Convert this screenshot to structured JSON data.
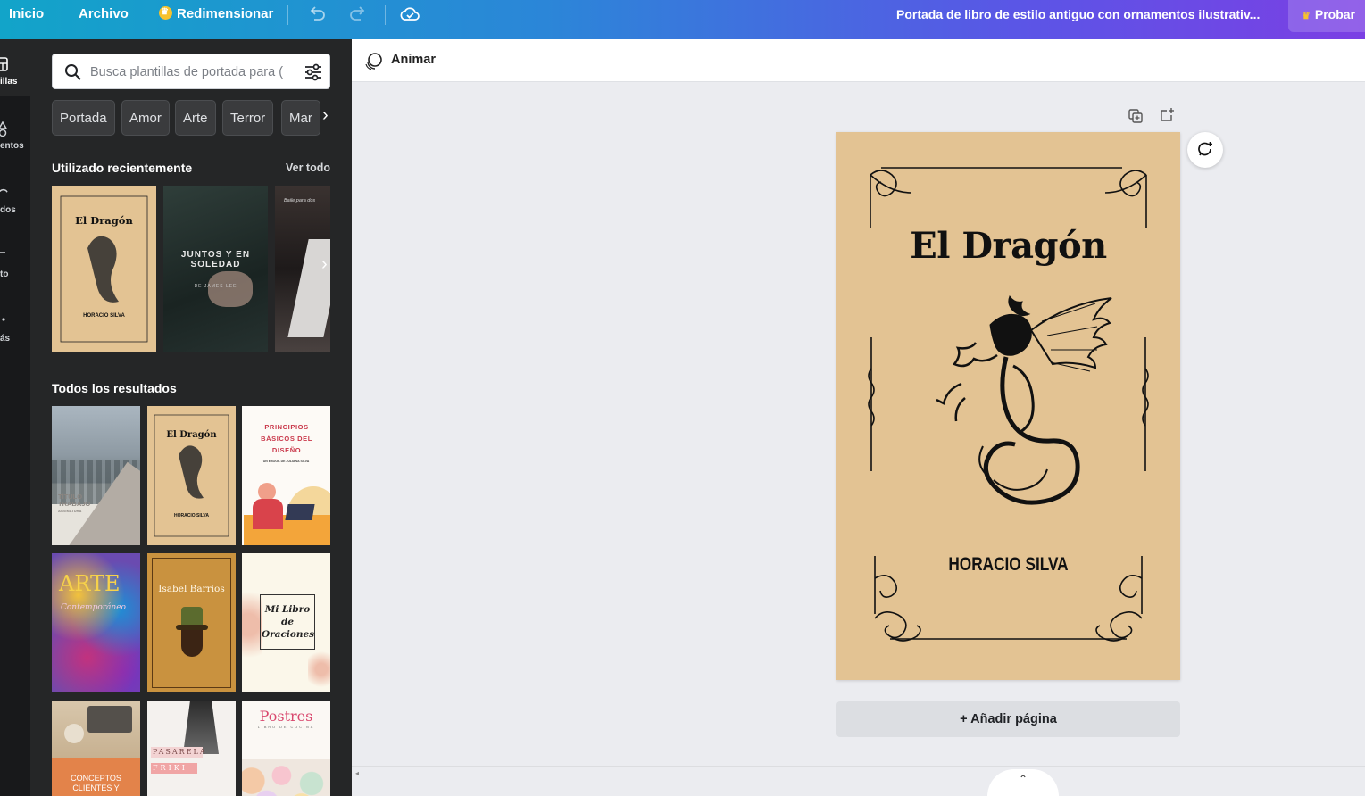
{
  "topbar": {
    "home": "Inicio",
    "file": "Archivo",
    "resize": "Redimensionar",
    "doc_title": "Portada de libro de estilo antiguo con ornamentos ilustrativ...",
    "try_pro": "Probar",
    "icons": [
      "undo-icon",
      "redo-icon",
      "cloud-saved-icon",
      "crown-icon"
    ]
  },
  "rail": {
    "items": [
      {
        "label": "illas",
        "icon": "templates-icon",
        "active": true
      },
      {
        "label": "entos",
        "icon": "elements-icon",
        "active": false
      },
      {
        "label": "dos",
        "icon": "uploads-icon",
        "active": false
      },
      {
        "label": "to",
        "icon": "text-icon",
        "active": false
      },
      {
        "label": "ás",
        "icon": "more-icon",
        "active": false
      }
    ]
  },
  "panel": {
    "search_placeholder": "Busca plantillas de portada para (",
    "chips": [
      "Portada",
      "Amor",
      "Arte",
      "Terror",
      "Mar"
    ],
    "recent_title": "Utilizado recientemente",
    "see_all": "Ver todo",
    "all_title": "Todos los resultados",
    "recent_thumbs": [
      {
        "title": "El Dragón",
        "author": "HORACIO SILVA"
      },
      {
        "title": "JUNTOS Y EN SOLEDAD",
        "author": "DE JAMES LEE"
      },
      {
        "title": "Baile para dos"
      }
    ],
    "results": [
      {
        "title": "TÍTULO TRABAJO",
        "subtitle": "ASIGNATURA"
      },
      {
        "title": "El Dragón",
        "author": "HORACIO SILVA"
      },
      {
        "title": "PRINCIPIOS BÁSICOS DEL DISEÑO",
        "subtitle": "UN EBOOK DE JULIANA SILVA"
      },
      {
        "title": "ARTE",
        "subtitle": "Contemporáneo"
      },
      {
        "title": "Isabel Barrios"
      },
      {
        "title": "Mi Libro de Oraciones"
      },
      {
        "title": "CONCEPTOS CLIENTES Y"
      },
      {
        "title": "PASARELA",
        "subtitle": "FRIKI"
      },
      {
        "title": "Postres",
        "subtitle": "LIBRO DE COCINA"
      }
    ]
  },
  "editor": {
    "animate": "Animar",
    "cover_title": "El Dragón",
    "cover_author": "HORACIO SILVA",
    "add_page": "+ Añadir página",
    "colors": {
      "page_bg": "#e3c393",
      "ink": "#111111"
    }
  }
}
